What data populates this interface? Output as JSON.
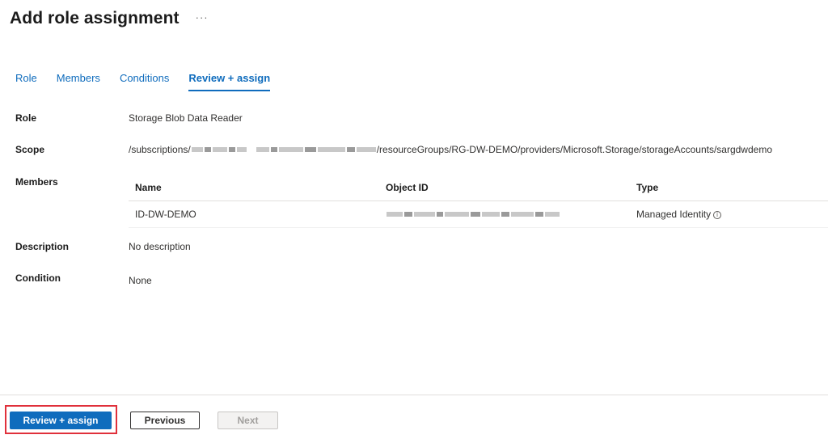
{
  "header": {
    "title": "Add role assignment",
    "more": "···"
  },
  "tabs": [
    {
      "label": "Role",
      "active": false
    },
    {
      "label": "Members",
      "active": false
    },
    {
      "label": "Conditions",
      "active": false
    },
    {
      "label": "Review + assign",
      "active": true
    }
  ],
  "details": {
    "role": {
      "label": "Role",
      "value": "Storage Blob Data Reader"
    },
    "scope": {
      "label": "Scope",
      "prefix": "/subscriptions/",
      "suffix": "/resourceGroups/RG-DW-DEMO/providers/Microsoft.Storage/storageAccounts/sargdwdemo"
    },
    "members": {
      "label": "Members",
      "columns": {
        "name": "Name",
        "object_id": "Object ID",
        "type": "Type"
      },
      "rows": [
        {
          "name": "ID-DW-DEMO",
          "type": "Managed Identity"
        }
      ]
    },
    "description": {
      "label": "Description",
      "value": "No description"
    },
    "condition": {
      "label": "Condition",
      "value": "None"
    }
  },
  "footer": {
    "review_assign": "Review + assign",
    "previous": "Previous",
    "next": "Next"
  },
  "colors": {
    "accent": "#0f6cbd",
    "highlight_border": "#e0303b"
  },
  "icons": {
    "info": "info-circle-icon",
    "more": "ellipsis-icon"
  }
}
